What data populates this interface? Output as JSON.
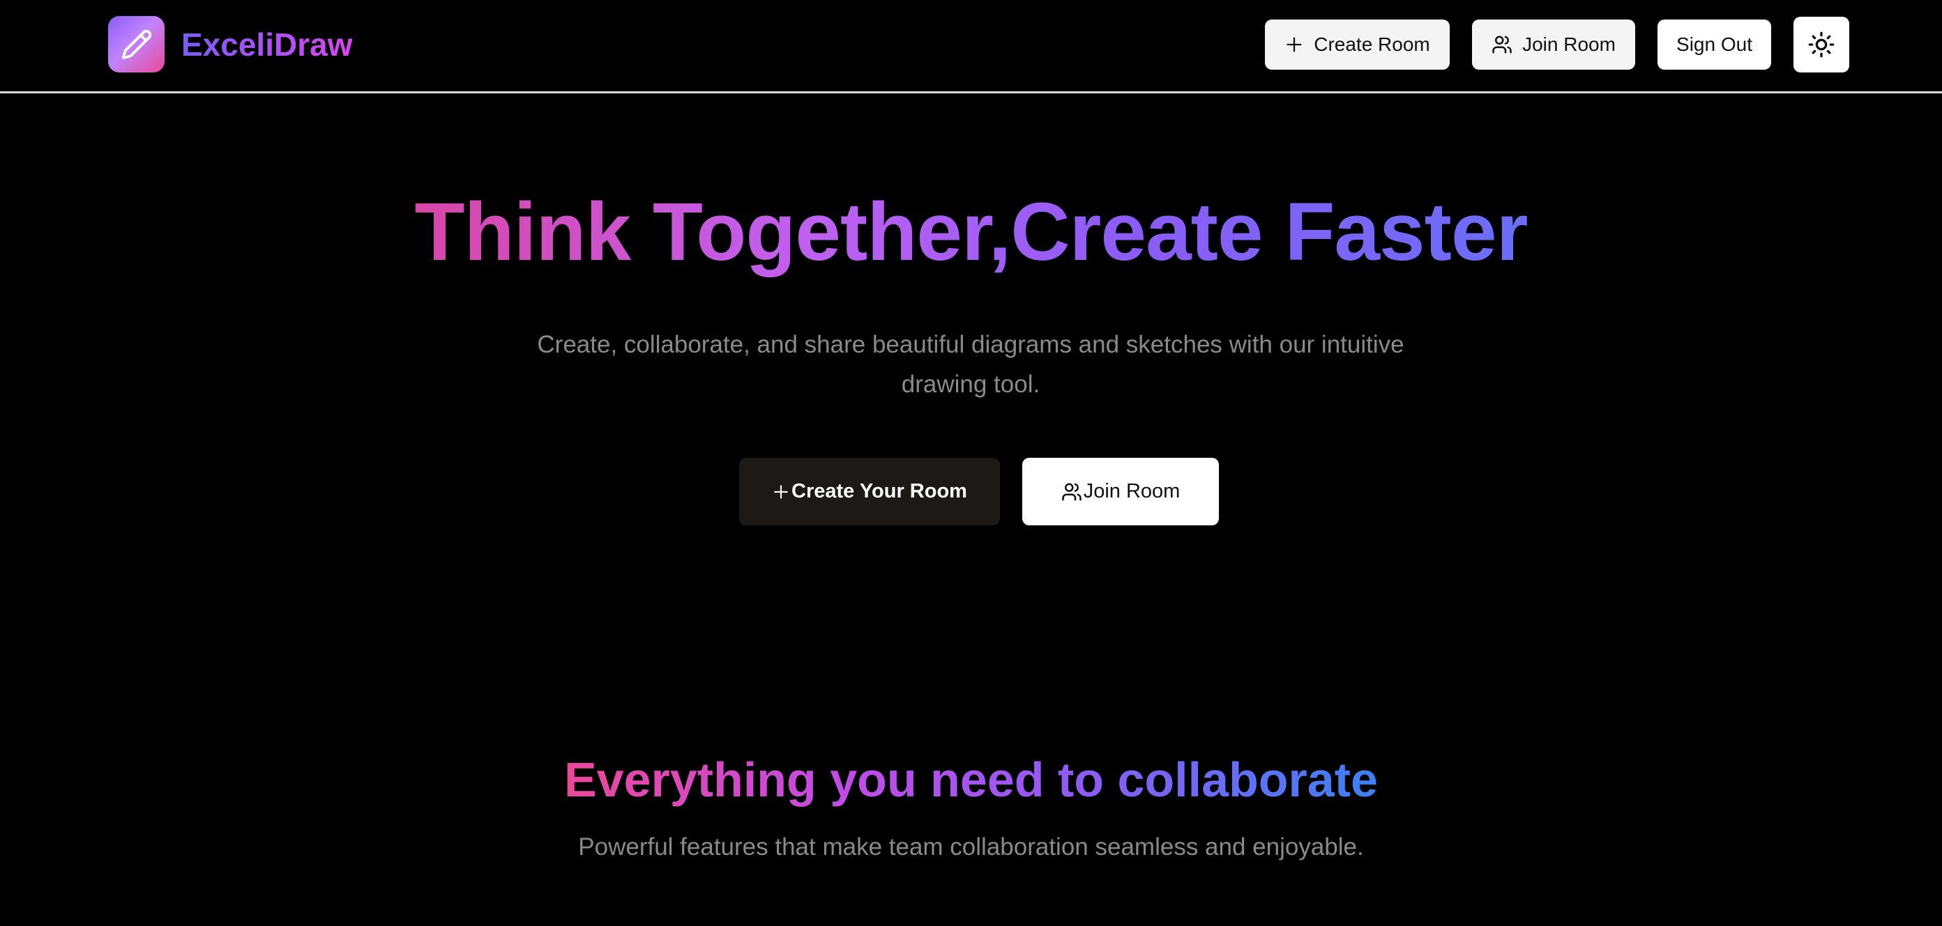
{
  "header": {
    "brand": "ExceliDraw",
    "logo_icon": "pencil-icon",
    "create_room_label": "Create Room",
    "join_room_label": "Join Room",
    "sign_out_label": "Sign Out",
    "theme_icon": "sun-icon"
  },
  "hero": {
    "title": "Think Together,Create Faster",
    "subtitle": "Create, collaborate, and share beautiful diagrams and sketches with our intuitive drawing tool.",
    "create_button_label": "Create Your Room",
    "join_button_label": "Join Room"
  },
  "features": {
    "title": "Everything you need to collaborate",
    "subtitle": "Powerful features that make team collaboration seamless and enjoyable."
  },
  "colors": {
    "background": "#000000",
    "brand_gradient_start": "#8b5cf6",
    "brand_gradient_end": "#ec4899",
    "muted_text": "#8a8a8a"
  }
}
